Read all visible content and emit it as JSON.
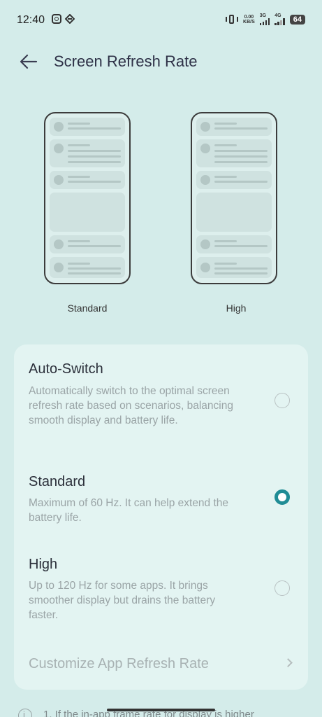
{
  "status_bar": {
    "time": "12:40",
    "net_speed_value": "0.00",
    "net_speed_unit": "KB/S",
    "sim1_label": "3G",
    "sim2_label": "4G",
    "battery": "64"
  },
  "header": {
    "title": "Screen Refresh Rate"
  },
  "previews": {
    "standard_label": "Standard",
    "high_label": "High"
  },
  "options": [
    {
      "title": "Auto-Switch",
      "description": "Automatically switch to the optimal screen refresh rate based on scenarios, balancing smooth display and battery life.",
      "selected": false
    },
    {
      "title": "Standard",
      "description": "Maximum of 60 Hz. It can help extend the battery life.",
      "selected": true
    },
    {
      "title": "High",
      "description": "Up to 120 Hz for some apps. It brings smoother display but drains the battery faster.",
      "selected": false
    }
  ],
  "customize": {
    "label": "Customize App Refresh Rate"
  },
  "note": {
    "text": "1. If the in-app frame rate for display is higher"
  },
  "colors": {
    "background": "#d4ecea",
    "card": "#e3f4f2",
    "accent": "#1f8c95"
  }
}
